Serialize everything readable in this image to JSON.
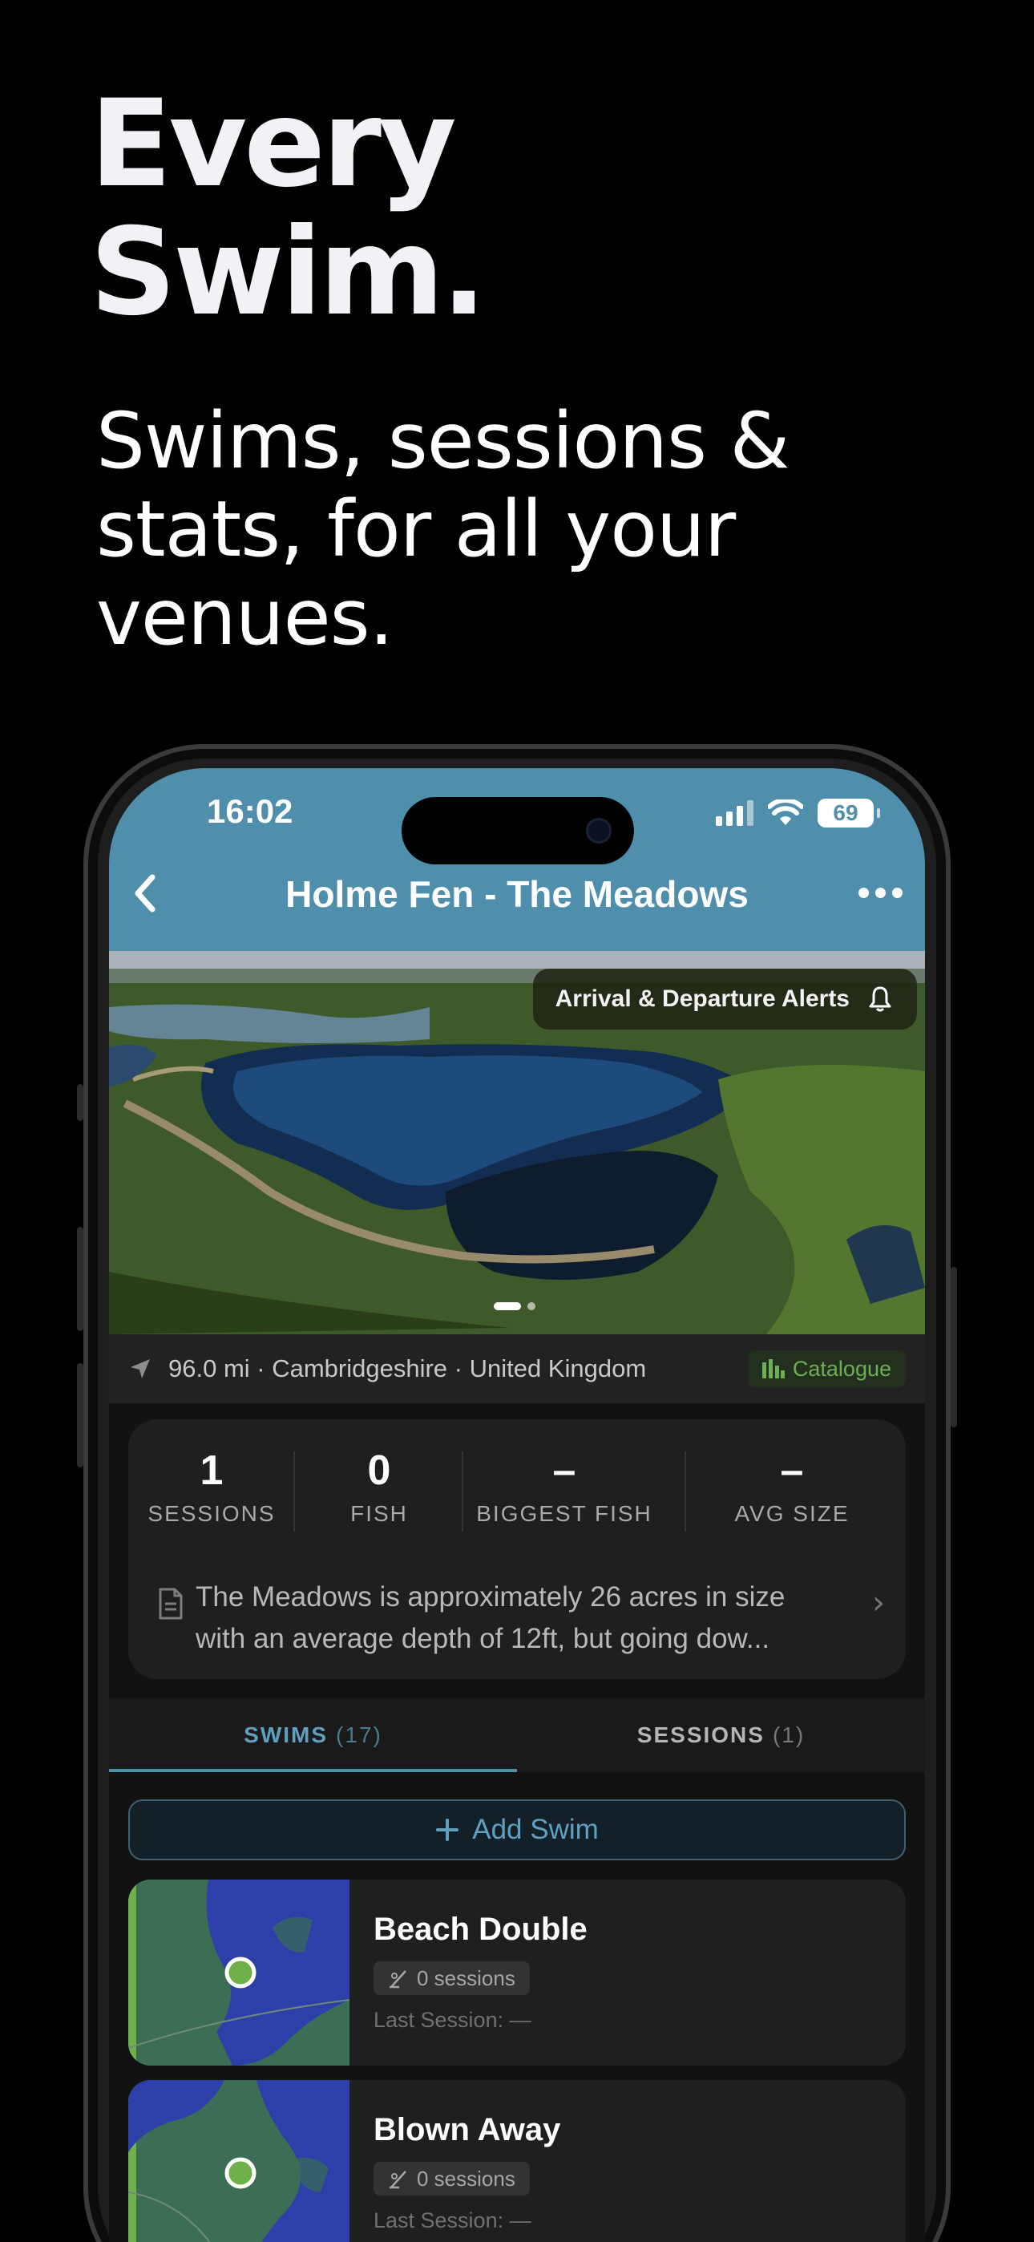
{
  "promo": {
    "headline_line1": "Every",
    "headline_line2": "Swim.",
    "subheadline": "Swims, sessions & stats, for all your venues."
  },
  "status_bar": {
    "time": "16:02",
    "battery": "69"
  },
  "nav": {
    "title": "Holme Fen - The Meadows"
  },
  "hero": {
    "alert_label": "Arrival & Departure Alerts",
    "page_count": 2,
    "current_page": 1
  },
  "location": {
    "text": "96.0 mi · Cambridgeshire · United Kingdom",
    "catalogue_label": "Catalogue"
  },
  "stats": [
    {
      "value": "1",
      "label": "SESSIONS"
    },
    {
      "value": "0",
      "label": "FISH"
    },
    {
      "value": "–",
      "label": "BIGGEST FISH"
    },
    {
      "value": "–",
      "label": "AVG SIZE"
    }
  ],
  "description": {
    "line1": "The Meadows is approximately 26 acres in size",
    "line2": "with an average depth of 12ft, but going dow..."
  },
  "tabs": [
    {
      "label": "SWIMS",
      "count": "(17)",
      "active": true
    },
    {
      "label": "SESSIONS",
      "count": "(1)",
      "active": false
    }
  ],
  "add_swim_label": "Add Swim",
  "swims": [
    {
      "name": "Beach Double",
      "sessions": "0 sessions",
      "last_session": "Last Session: —"
    },
    {
      "name": "Blown Away",
      "sessions": "0 sessions",
      "last_session": "Last Session: —"
    }
  ],
  "colors": {
    "header": "#4f8fac",
    "accent_green": "#6dae55",
    "map_water": "#2d3fa8",
    "map_land": "#3b6e55"
  },
  "icons": [
    "back-chevron-icon",
    "more-dots-icon",
    "bell-icon",
    "location-arrow-icon",
    "catalogue-bars-icon",
    "document-icon",
    "chevron-right-icon",
    "plus-icon",
    "rod-icon",
    "signal-icon",
    "wifi-icon",
    "battery-icon"
  ]
}
